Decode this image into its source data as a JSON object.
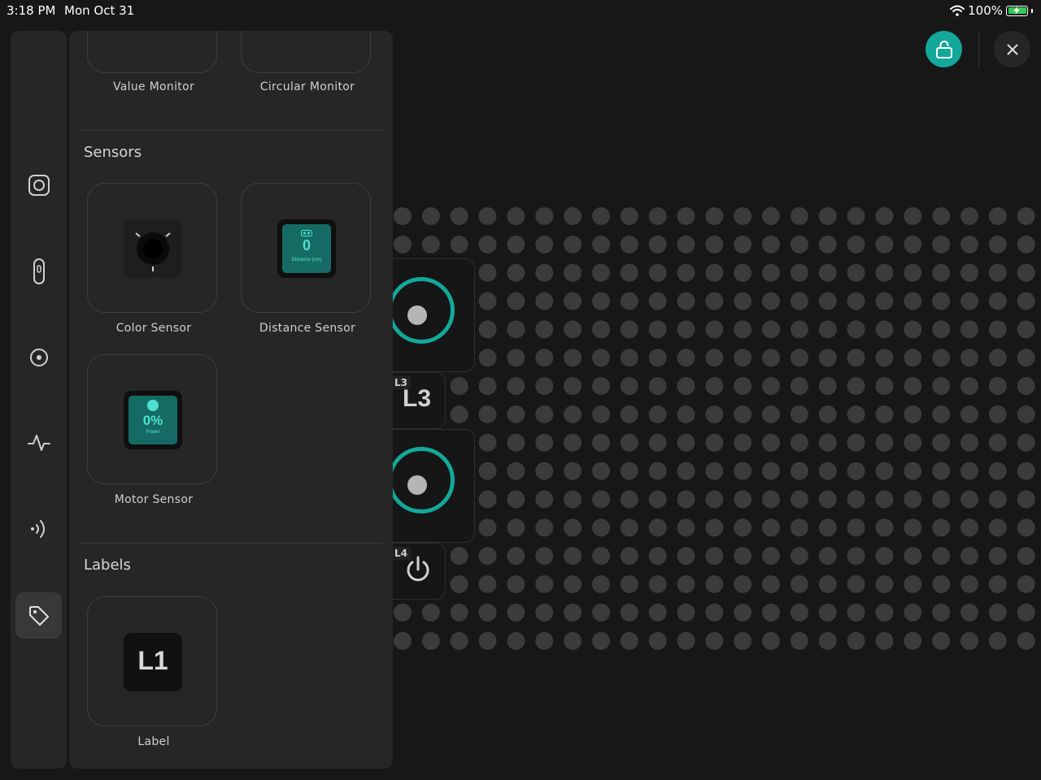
{
  "status_bar": {
    "time": "3:18 PM",
    "date": "Mon Oct 31",
    "battery_text": "100%",
    "battery_level": 1.0
  },
  "colors": {
    "accent": "#13a89a",
    "background": "#171717",
    "panel": "#262626",
    "dot": "#3b3b3b"
  },
  "toolbar": {
    "lock_icon": "unlock-icon",
    "close_icon": "close-icon"
  },
  "rail": {
    "items": [
      {
        "icon": "camera-square-icon",
        "active": false
      },
      {
        "icon": "remote-icon",
        "active": false
      },
      {
        "icon": "target-circle-icon",
        "active": false
      },
      {
        "icon": "pulse-icon",
        "active": false
      },
      {
        "icon": "sound-wave-icon",
        "active": false
      },
      {
        "icon": "tag-icon",
        "active": true
      }
    ]
  },
  "panel": {
    "monitors": {
      "value_monitor_label": "Value Monitor",
      "circular_monitor_label": "Circular Monitor"
    },
    "sensors": {
      "title": "Sensors",
      "color_sensor_label": "Color Sensor",
      "distance_sensor_label": "Distance Sensor",
      "distance_value": "0",
      "distance_caption": "Distance (cm)",
      "motor_sensor_label": "Motor Sensor",
      "motor_value": "0%",
      "motor_caption": "Power"
    },
    "labels": {
      "title": "Labels",
      "label_tile_text": "L1",
      "label_tile_label": "Label"
    }
  },
  "canvas": {
    "l3_tag": "L3",
    "l3_text": "L3",
    "l4_tag": "L4",
    "l4_icon": "power-icon"
  }
}
